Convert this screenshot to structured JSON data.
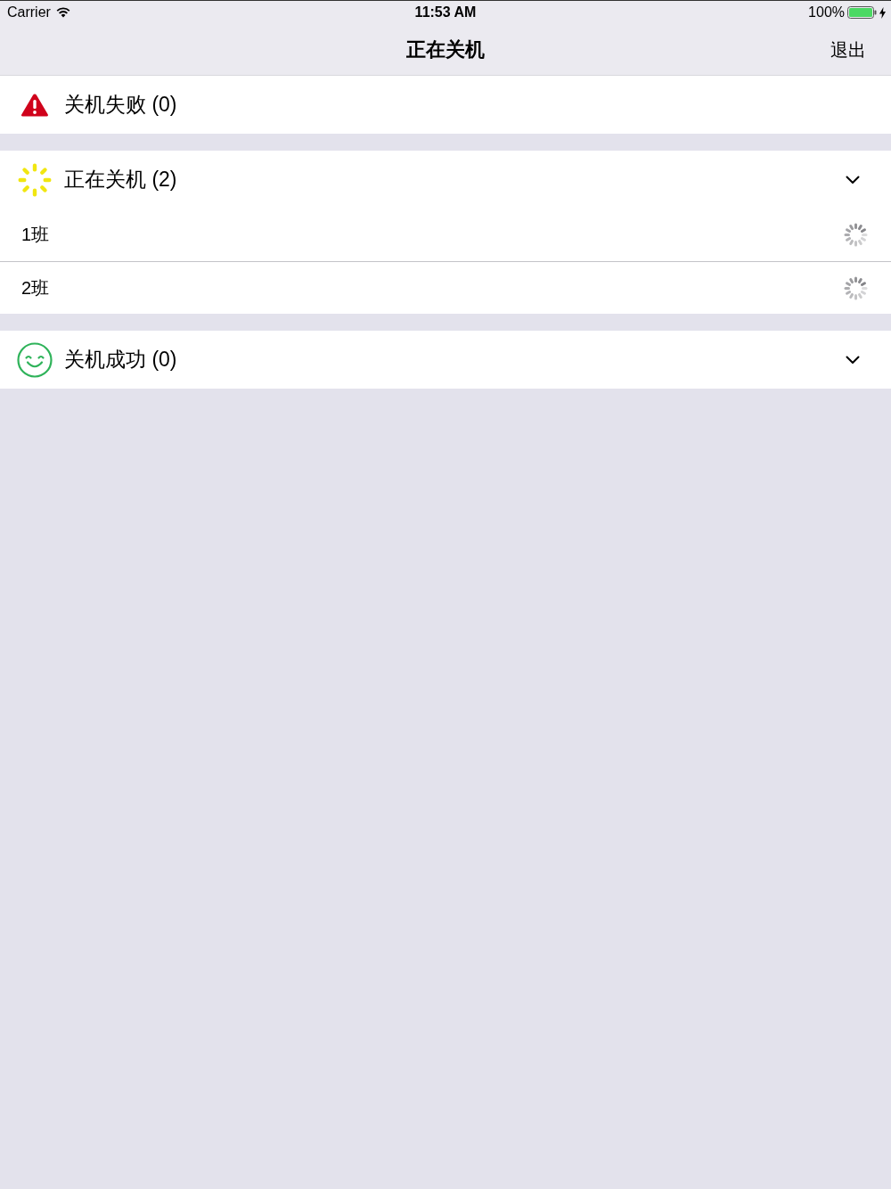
{
  "status_bar": {
    "carrier": "Carrier",
    "time": "11:53 AM",
    "battery_percent": "100%",
    "charging": true
  },
  "nav_bar": {
    "title": "正在关机",
    "right_button": "退出"
  },
  "sections": [
    {
      "kind": "failed",
      "title": "关机失败 (0)",
      "collapsible": false
    },
    {
      "kind": "in_progress",
      "title": "正在关机 (2)",
      "collapsible": true,
      "rows": [
        {
          "label": "1班"
        },
        {
          "label": "2班"
        }
      ]
    },
    {
      "kind": "success",
      "title": "关机成功 (0)",
      "collapsible": true
    }
  ]
}
